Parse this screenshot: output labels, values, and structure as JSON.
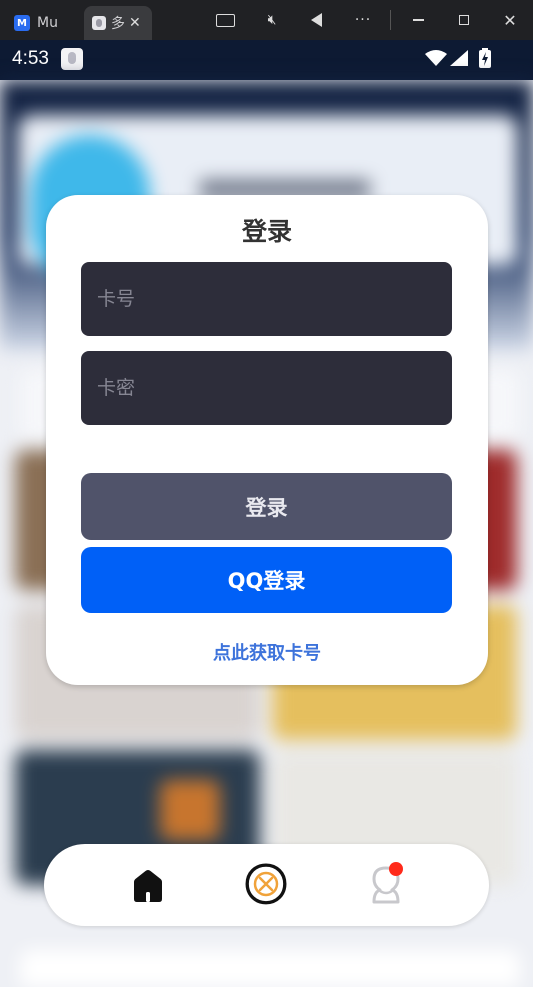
{
  "titlebar": {
    "tabs": [
      {
        "label": "Mu",
        "icon": "app-logo-icon"
      },
      {
        "label": "多",
        "icon": "page-favicon-icon"
      }
    ],
    "controls": [
      "keyboard-icon",
      "mute-icon",
      "back-icon",
      "more-icon",
      "minimize-icon",
      "maximize-icon",
      "close-icon"
    ]
  },
  "statusbar": {
    "time": "4:53"
  },
  "login": {
    "title": "登录",
    "card_placeholder": "卡号",
    "password_placeholder": "卡密",
    "login_button": "登录",
    "qq_button": "QQ登录",
    "get_card_link": "点此获取卡号"
  },
  "bottom_nav": {
    "items": [
      "home-icon",
      "center-logo-icon",
      "profile-icon"
    ],
    "has_notification": true
  },
  "colors": {
    "primary_blue": "#0060f7",
    "link_blue": "#3d73db",
    "input_bg": "#2d2d3a",
    "login_btn": "#50536a",
    "accent_orange": "#f0a23a",
    "notify_red": "#ff2a1a"
  }
}
